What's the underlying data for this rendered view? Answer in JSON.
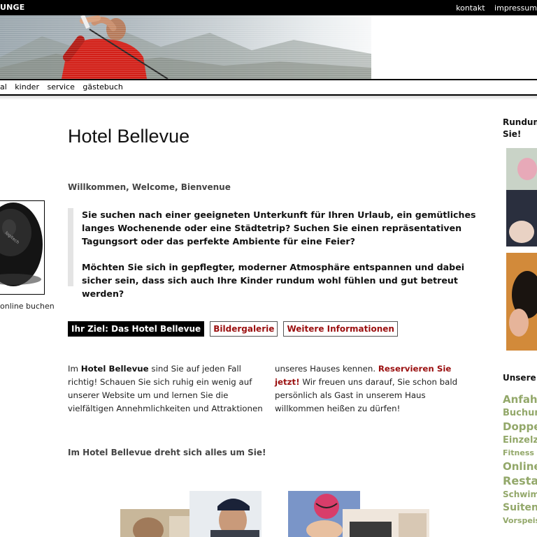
{
  "brand": "UNGE",
  "top_links": [
    "kontakt",
    "impressum"
  ],
  "nav": [
    "al",
    "kinder",
    "service",
    "gästebuch"
  ],
  "left": {
    "online_link": "online buchen"
  },
  "main": {
    "title": "Hotel Bellevue",
    "welcome": "Willkommen, Welcome, Bienvenue",
    "intro_p1": "Sie suchen nach einer geeigneten Unterkunft für Ihren Urlaub, ein gemütliches langes Wochenende oder eine Städtetrip? Suchen Sie einen repräsentativen Tagungsort oder das perfekte Ambiente für eine Feier?",
    "intro_p2": "Möchten Sie sich in gepflegter, moderner Atmosphäre entspannen und dabei sicher sein, dass sich auch Ihre Kinder rundum wohl fühlen und gut betreut werden?",
    "tabs": [
      "Ihr Ziel: Das Hotel Bellevue",
      "Bildergalerie",
      "Weitere Informationen"
    ],
    "col1_pre": "Im ",
    "col1_bold": "Hotel Bellevue",
    "col1_post": " sind Sie auf jeden Fall richtig! Schauen Sie sich ruhig ein wenig auf unserer Website um und lernen Sie die vielfältigen Annehmlichkeiten und Attraktionen",
    "col2_pre": "unseres Hauses kennen. ",
    "col2_link": "Reservieren Sie jetzt!",
    "col2_post": " Wir freuen uns darauf, Sie schon bald persönlich als Gast in unserem Haus willkommen heißen zu dürfen!",
    "tagline": "Im Hotel Bellevue dreht sich alles um Sie!"
  },
  "right": {
    "heading": "Rundum Sie!",
    "unsere": "Unsere",
    "tags": [
      {
        "text": "Anfahrt",
        "size": 15
      },
      {
        "text": "Buchung",
        "size": 13
      },
      {
        "text": "Doppel",
        "size": 15
      },
      {
        "text": "Einzelz",
        "size": 13
      },
      {
        "text": "Fitness",
        "size": 11
      },
      {
        "text": "Online",
        "size": 15
      },
      {
        "text": "Restau",
        "size": 16
      },
      {
        "text": "Schwim",
        "size": 12
      },
      {
        "text": "Suiten",
        "size": 14
      },
      {
        "text": "Vorspeis",
        "size": 11
      }
    ]
  },
  "colors": {
    "accent_red": "#9a0f0f",
    "tag_green": "#93a86a",
    "black": "#000000"
  }
}
